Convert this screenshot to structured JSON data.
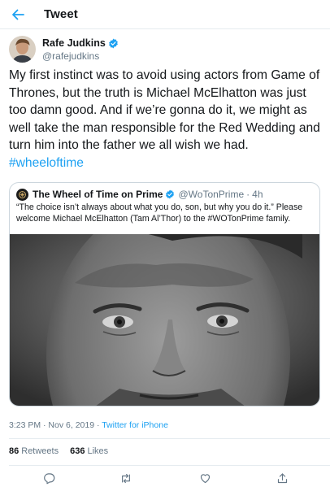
{
  "header": {
    "title": "Tweet"
  },
  "author": {
    "display_name": "Rafe Judkins",
    "handle": "@rafejudkins"
  },
  "tweet": {
    "text": "My first instinct was to avoid using actors from Game of Thrones, but the truth is Michael McElhatton was just too damn good. And if we’re gonna do it, we might as well take the man responsible for the Red Wedding and turn him into the father we all wish we had.",
    "hashtag": "#wheeloftime"
  },
  "quoted": {
    "display_name": "The Wheel of Time on Prime",
    "handle": "@WoTonPrime",
    "separator": "·",
    "time": "4h",
    "text": "“The choice isn’t always about what you do, son, but why you do it.” Please welcome Michael McElhatton (Tam Al’Thor) to the #WOTonPrime family."
  },
  "meta": {
    "timestamp": "3:23 PM · Nov 6, 2019 · ",
    "source": "Twitter for iPhone"
  },
  "stats": {
    "retweets_count": "86",
    "retweets_label": "Retweets",
    "likes_count": "636",
    "likes_label": "Likes"
  },
  "icons": {
    "back": "arrow-left-icon",
    "verified": "verified-badge-icon",
    "reply": "reply-icon",
    "retweet": "retweet-icon",
    "like": "heart-icon",
    "share": "share-icon"
  },
  "colors": {
    "accent": "#1da1f2",
    "secondary_text": "#657786",
    "border": "#ccd6dd"
  }
}
